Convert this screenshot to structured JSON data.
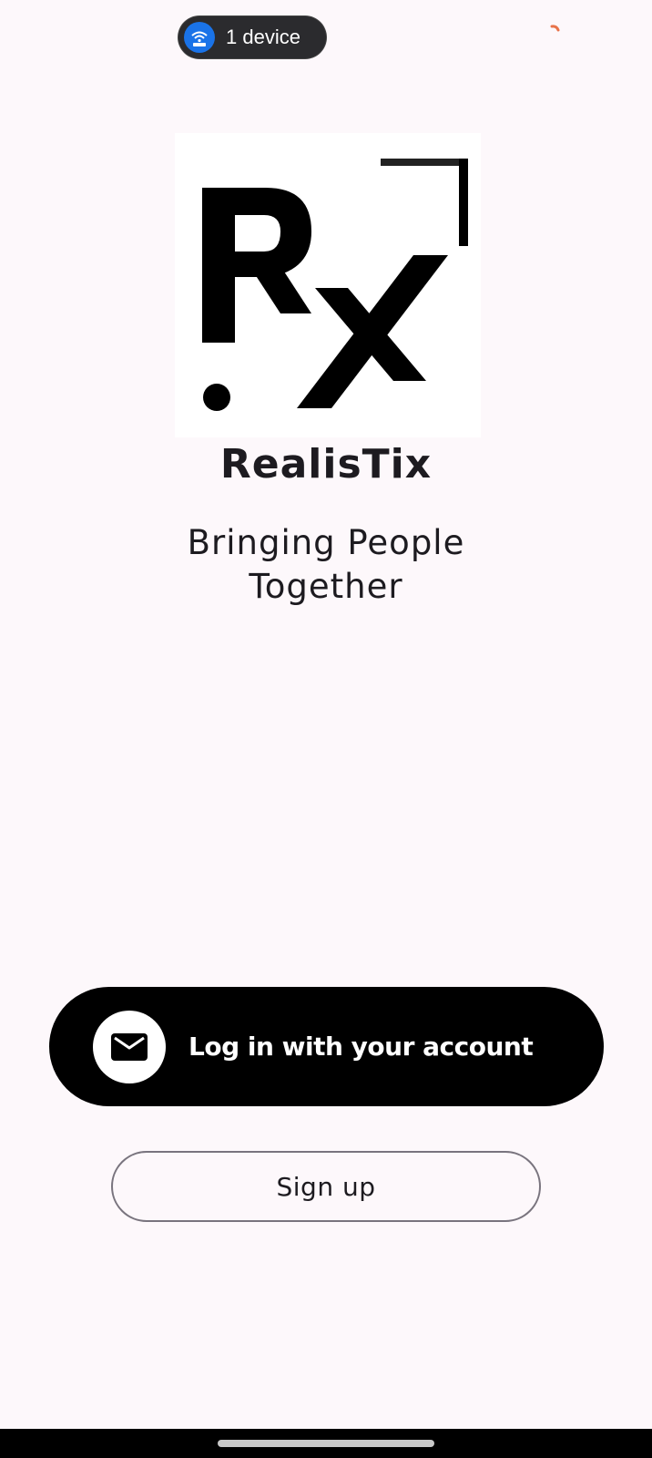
{
  "status_bar": {
    "device_pill_text": "1 device",
    "device_icon": "wifi-router-icon",
    "loading_icon": "loading-spinner-icon",
    "pill_color": "#2b2b2e",
    "icon_color": "#1a73e8"
  },
  "logo": {
    "icon": "realistix-rx-logo"
  },
  "app": {
    "name": "RealisTix",
    "tagline_line1": "Bringing People",
    "tagline_line2": "Together"
  },
  "actions": {
    "login_label": "Log in with your account",
    "login_icon": "mail-icon",
    "signup_label": "Sign up"
  },
  "colors": {
    "background": "#fdf8fb",
    "primary_button": "#000000",
    "outline": "#79747e",
    "spinner": "#e8734a"
  }
}
